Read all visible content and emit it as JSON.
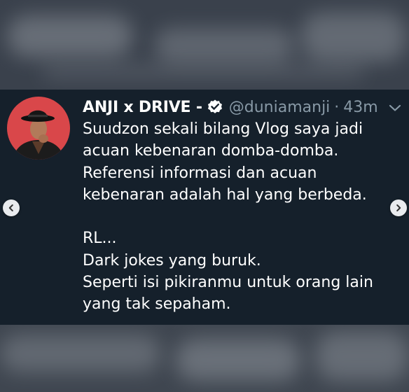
{
  "tweet": {
    "author_name": "ANJI x DRIVE -",
    "handle": "@duniamanji",
    "separator": "·",
    "time": "43m",
    "lines": [
      "Suudzon sekali bilang Vlog saya jadi",
      "acuan kebenaran domba-domba.",
      "Referensi informasi dan acuan",
      "kebenaran adalah hal yang berbeda.",
      "",
      "RL...",
      "Dark jokes yang buruk.",
      "Seperti isi pikiranmu untuk orang lain",
      "yang tak sepaham."
    ]
  },
  "colors": {
    "tweet_background": "#15202b",
    "text": "#ffffff",
    "muted": "#8899a6",
    "avatar_background": "#d9474a"
  },
  "icons": {
    "verified": "verified-badge-icon",
    "menu": "chevron-down-icon",
    "prev": "chevron-left-icon",
    "next": "chevron-right-icon"
  }
}
